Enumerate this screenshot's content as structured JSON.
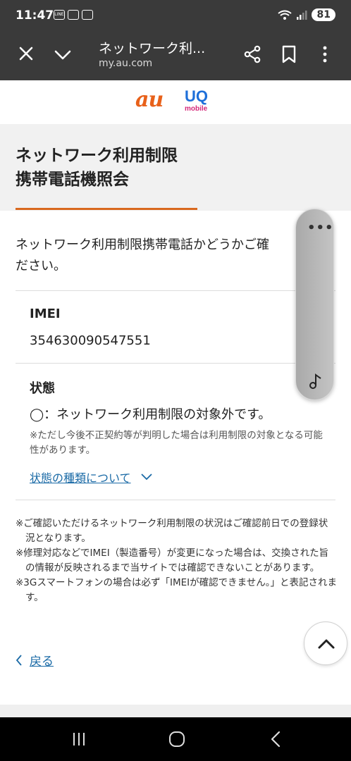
{
  "status_bar": {
    "time": "11:47",
    "battery": "81"
  },
  "toolbar": {
    "title": "ネットワーク利...",
    "url": "my.au.com"
  },
  "logos": {
    "au": "au",
    "uq": "UQ",
    "uq_sub": "mobile"
  },
  "page": {
    "title_line1": "ネットワーク利用制限",
    "title_line2": "携帯電話機照会",
    "intro_line1": "ネットワーク利用制限携帯電話かどうかご確",
    "intro_line2": "ださい。",
    "imei_label": "IMEI",
    "imei_value": "354630090547551",
    "state_label": "状態",
    "state_value": "◯：ネットワーク利用制限の対象外です。",
    "state_note": "※ただし今後不正契約等が判明した場合は利用制限の対象となる可能性があります。",
    "state_link": "状態の種類について",
    "footnotes": [
      "※ご確認いただけるネットワーク利用制限の状況はご確認前日での登録状況となります。",
      "※修理対応などでIMEI（製造番号）が変更になった場合は、交換された旨の情報が反映されるまで当サイトでは確認できないことがあります。",
      "※3Gスマートフォンの場合は必ず「IMEIが確認できません。」と表記されます。"
    ],
    "back_label": "戻る"
  },
  "side_panel": {
    "menu": "•••"
  },
  "colors": {
    "accent_orange": "#d9691f",
    "link_blue": "#1a6aa6",
    "toolbar_bg": "#3a3a3a"
  }
}
